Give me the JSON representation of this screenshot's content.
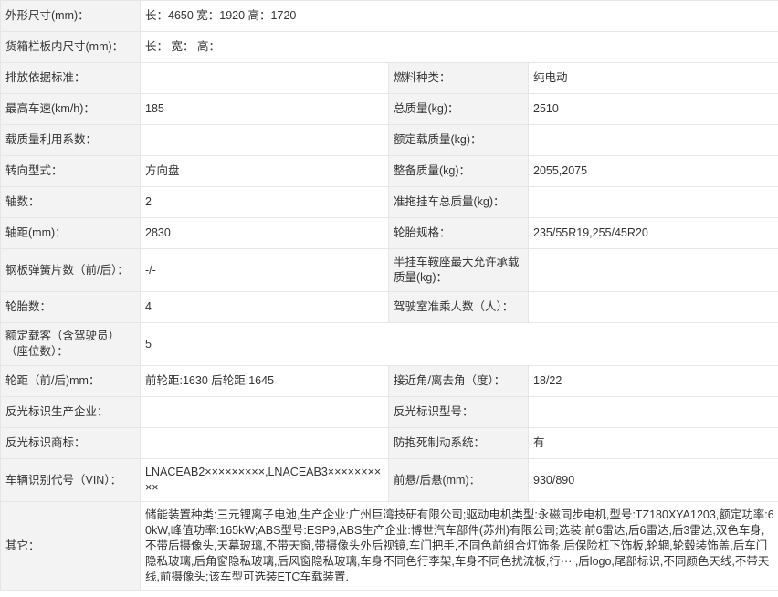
{
  "rows": [
    {
      "label": "外形尺寸(mm)：",
      "value": "长：4650 宽：1920 高：1720"
    },
    {
      "label": "货箱栏板内尺寸(mm)：",
      "value": "长：  宽：  高："
    },
    {
      "label": "排放依据标准：",
      "value": "",
      "label2": "燃料种类：",
      "value2": "纯电动"
    },
    {
      "label": "最高车速(km/h)：",
      "value": "185",
      "label2": "总质量(kg)：",
      "value2": "2510"
    },
    {
      "label": "载质量利用系数：",
      "value": "",
      "label2": "额定载质量(kg)：",
      "value2": ""
    },
    {
      "label": "转向型式：",
      "value": "方向盘",
      "label2": "整备质量(kg)：",
      "value2": "2055,2075"
    },
    {
      "label": "轴数：",
      "value": "2",
      "label2": "准拖挂车总质量(kg)：",
      "value2": ""
    },
    {
      "label": "轴距(mm)：",
      "value": "2830",
      "label2": "轮胎规格：",
      "value2": "235/55R19,255/45R20"
    },
    {
      "label": "钢板弹簧片数（前/后）：",
      "value": "-/-",
      "label2": "半挂车鞍座最大允许承载质量(kg)：",
      "value2": ""
    },
    {
      "label": "轮胎数：",
      "value": "4",
      "label2": "驾驶室准乘人数（人）：",
      "value2": ""
    },
    {
      "label": "额定载客（含驾驶员）（座位数）：",
      "value": "5",
      "label2": "",
      "value2": ""
    },
    {
      "label": "轮距（前/后)mm：",
      "value": "前轮距:1630 后轮距:1645",
      "label2": "接近角/离去角（度）：",
      "value2": "18/22"
    },
    {
      "label": "反光标识生产企业：",
      "value": "",
      "label2": "反光标识型号：",
      "value2": ""
    },
    {
      "label": "反光标识商标：",
      "value": "",
      "label2": "防抱死制动系统：",
      "value2": "有"
    },
    {
      "label": "车辆识别代号（VIN）：",
      "value": "LNACEAB2×××××××××,LNACEAB3××××××××××",
      "label2": "前悬/后悬(mm)：",
      "value2": "930/890"
    },
    {
      "label": "其它：",
      "value": "储能装置种类:三元锂离子电池,生产企业:广州巨湾技研有限公司;驱动电机类型:永磁同步电机,型号:TZ180XYA1203,额定功率:60kW,峰值功率:165kW;ABS型号:ESP9,ABS生产企业:博世汽车部件(苏州)有限公司;选装:前6雷达,后6雷达,后3雷达,双色车身,不带后摄像头,天幕玻璃,不带天窗,带摄像头外后视镜,车门把手,不同色前组合灯饰条,后保险杠下饰板,轮辋,轮毂装饰盖,后车门隐私玻璃,后角窗隐私玻璃,后风窗隐私玻璃,车身不同色行李架,车身不同色扰流板,行··· ,后logo,尾部标识,不同颜色天线,不带天线,前摄像头;该车型可选装ETC车载装置."
    }
  ]
}
